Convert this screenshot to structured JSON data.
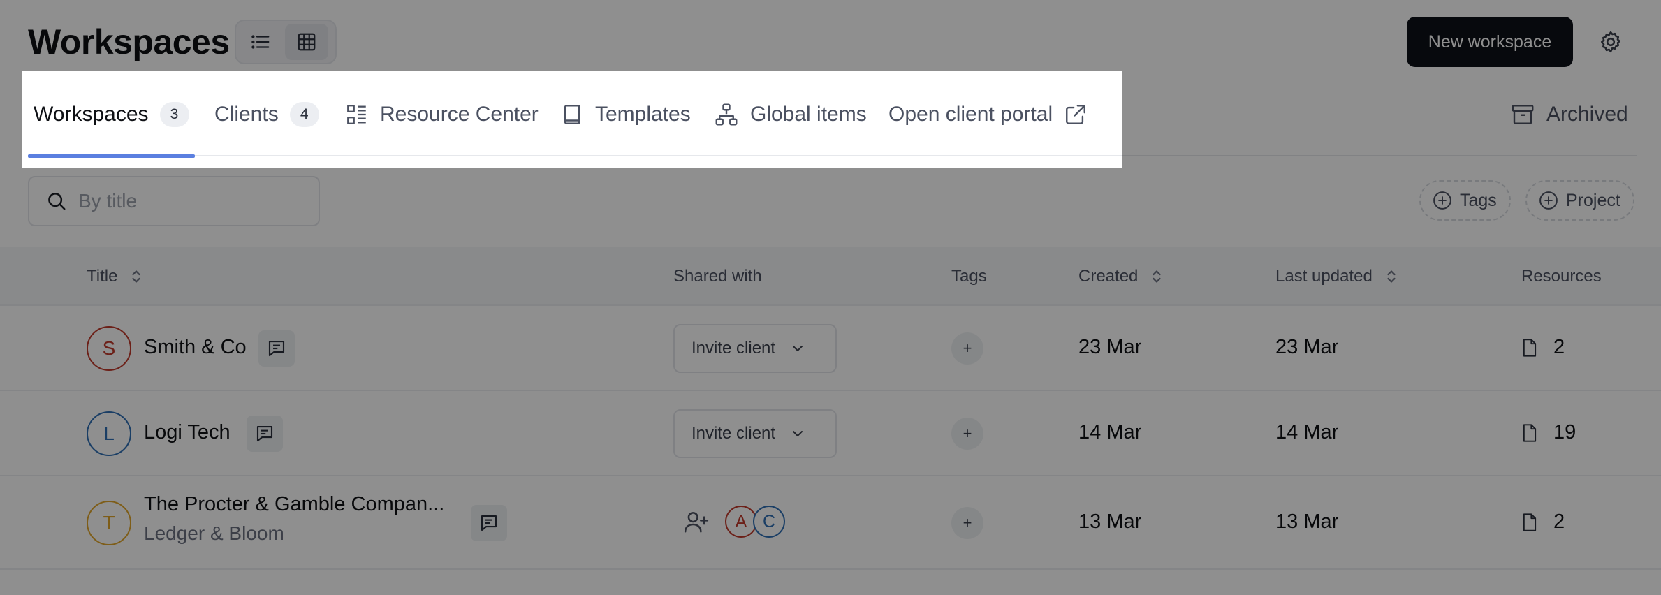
{
  "header": {
    "title": "Workspaces",
    "new_button": "New workspace",
    "view_modes": [
      "list-icon",
      "grid-icon"
    ],
    "active_view": "grid"
  },
  "tabs": [
    {
      "label": "Workspaces",
      "count": "3",
      "active": true
    },
    {
      "label": "Clients",
      "count": "4"
    },
    {
      "label": "Resource Center",
      "icon": "resource-list-icon"
    },
    {
      "label": "Templates",
      "icon": "book-icon"
    },
    {
      "label": "Global items",
      "icon": "hierarchy-icon"
    },
    {
      "label": "Open client portal",
      "icon": "external-link-icon"
    }
  ],
  "archived_label": "Archived",
  "search": {
    "placeholder": "By title"
  },
  "filters": {
    "tags": "Tags",
    "project": "Project"
  },
  "table": {
    "headers": {
      "title": "Title",
      "shared_with": "Shared with",
      "tags": "Tags",
      "created": "Created",
      "last_updated": "Last updated",
      "resources": "Resources"
    },
    "invite_label": "Invite client",
    "tag_add": "+",
    "rows": [
      {
        "initial": "S",
        "title": "Smith & Co",
        "subtitle": "",
        "created": "23 Mar",
        "updated": "23 Mar",
        "resources": "2",
        "avatar_color": "#c0392b"
      },
      {
        "initial": "L",
        "title": "Logi Tech",
        "subtitle": "",
        "created": "14 Mar",
        "updated": "14 Mar",
        "resources": "19",
        "avatar_color": "#2f6fb5"
      },
      {
        "initial": "T",
        "title": "The Procter & Gamble Compan...",
        "subtitle": "Ledger & Bloom",
        "created": "13 Mar",
        "updated": "13 Mar",
        "resources": "2",
        "avatar_color": "#e0a62b",
        "shared": [
          {
            "initial": "A",
            "color": "#c0392b"
          },
          {
            "initial": "C",
            "color": "#2f6fb5"
          }
        ]
      }
    ]
  },
  "colors": {
    "accent": "#5b7fe0",
    "primary_button": "#0e1118"
  }
}
